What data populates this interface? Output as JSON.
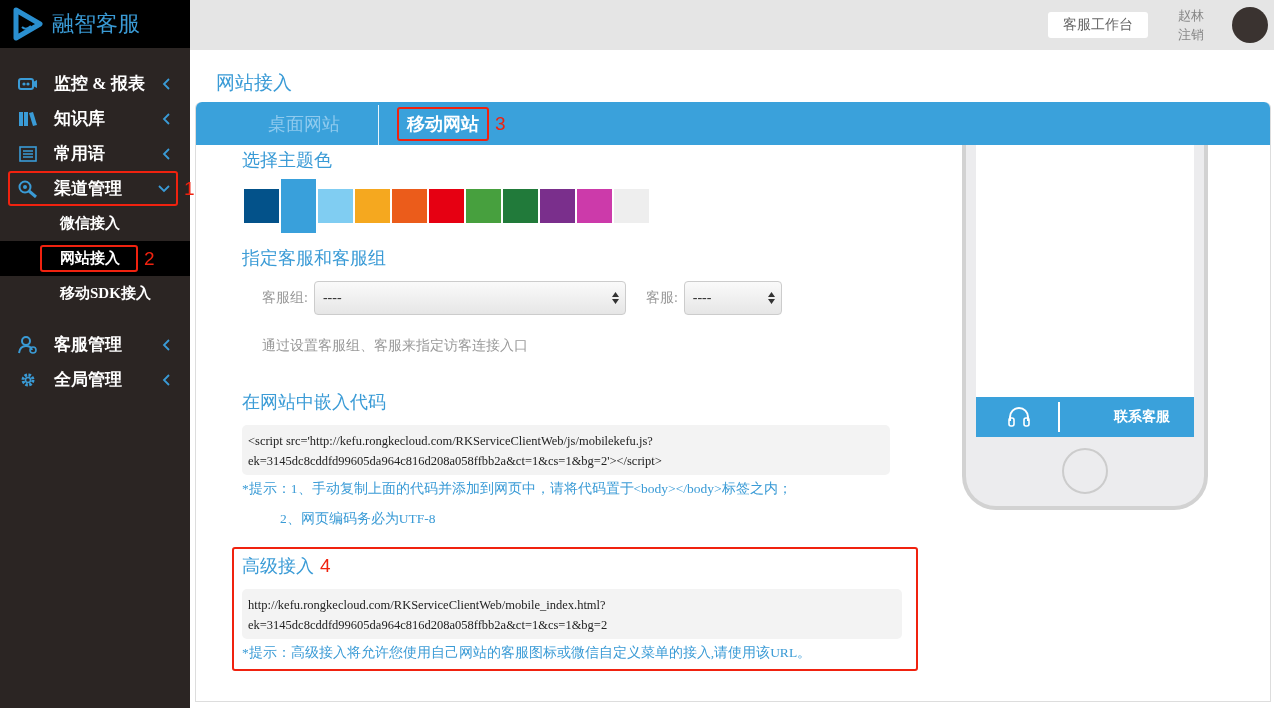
{
  "logo": {
    "text": "融智客服"
  },
  "header": {
    "workbench_button": "客服工作台",
    "user_name": "赵林",
    "logout": "注销"
  },
  "sidebar": {
    "items": [
      {
        "label": "监控 & 报表",
        "expanded": false
      },
      {
        "label": "知识库",
        "expanded": false
      },
      {
        "label": "常用语",
        "expanded": false
      },
      {
        "label": "渠道管理",
        "expanded": true,
        "annotation": "1",
        "children": [
          {
            "label": "微信接入",
            "selected": false
          },
          {
            "label": "网站接入",
            "selected": true,
            "annotation": "2"
          },
          {
            "label": "移动SDK接入",
            "selected": false
          }
        ]
      },
      {
        "label": "客服管理",
        "expanded": false
      },
      {
        "label": "全局管理",
        "expanded": false
      }
    ]
  },
  "page_title": "网站接入",
  "tabs": [
    {
      "label": "桌面网站",
      "selected": false
    },
    {
      "label": "移动网站",
      "selected": true,
      "annotation": "3"
    }
  ],
  "theme": {
    "heading": "选择主题色",
    "colors": [
      {
        "color": "#03528a",
        "selected": false
      },
      {
        "color": "#39a0db",
        "selected": true
      },
      {
        "color": "#80cdf2",
        "selected": false
      },
      {
        "color": "#f5a81f",
        "selected": false
      },
      {
        "color": "#eb5c1b",
        "selected": false
      },
      {
        "color": "#e60012",
        "selected": false
      },
      {
        "color": "#47a03e",
        "selected": false
      },
      {
        "color": "#217a3a",
        "selected": false
      },
      {
        "color": "#7a2f8c",
        "selected": false
      },
      {
        "color": "#cc3aaa",
        "selected": false
      },
      {
        "color": "#eeeeee",
        "selected": false
      }
    ]
  },
  "agent": {
    "heading": "指定客服和客服组",
    "group_label": "客服组:",
    "group_value": "----",
    "agent_label": "客服:",
    "agent_value": "----",
    "hint": "通过设置客服组、客服来指定访客连接入口"
  },
  "embed": {
    "heading": "在网站中嵌入代码",
    "code_lines": [
      "<script src='http://kefu.rongkecloud.com/RKServiceClientWeb/js/mobilekefu.js?",
      "ek=3145dc8cddfd99605da964c816d208a058ffbb2a&ct=1&cs=1&bg=2'></script>"
    ],
    "notes": [
      "*提示：1、手动复制上面的代码并添加到网页中，请将代码置于<body></body>标签之内；",
      "2、网页编码务必为UTF-8"
    ]
  },
  "advanced": {
    "heading": "高级接入",
    "annotation": "4",
    "url_lines": [
      "http://kefu.rongkecloud.com/RKServiceClientWeb/mobile_index.html?",
      "ek=3145dc8cddfd99605da964c816d208a058ffbb2a&ct=1&cs=1&bg=2"
    ],
    "note": "*提示：高级接入将允许您使用自己网站的客服图标或微信自定义菜单的接入,请使用该URL。"
  },
  "phone_preview": {
    "contact_label": "联系客服"
  }
}
